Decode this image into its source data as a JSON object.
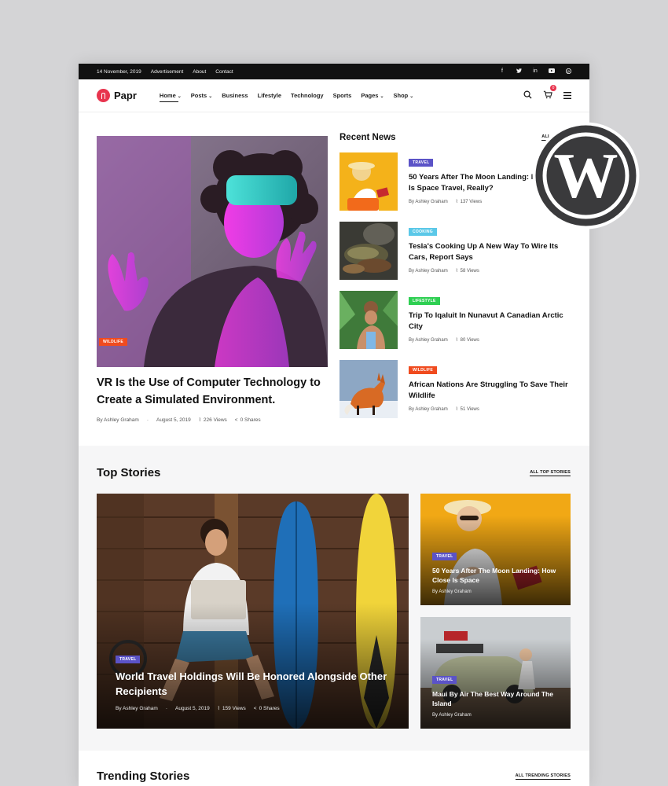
{
  "topbar": {
    "date": "14 November, 2019",
    "links": [
      "Advertisement",
      "About",
      "Contact"
    ],
    "social": [
      "f",
      "t",
      "in",
      "yt",
      "p"
    ]
  },
  "nav": {
    "logo": "Papr",
    "menu": [
      "Home",
      "Posts",
      "Business",
      "Lifestyle",
      "Technology",
      "Sports",
      "Pages",
      "Shop"
    ],
    "cart_count": "0"
  },
  "hero": {
    "badge": "WILDLIFE",
    "title": "VR Is the Use of Computer Technology to Create a Simulated Environment.",
    "author": "By Ashley Graham",
    "date": "August 5, 2019",
    "views": "226 Views",
    "shares": "0 Shares"
  },
  "recent": {
    "heading": "Recent News",
    "all_link": "ALL RECENT",
    "items": [
      {
        "badge": "TRAVEL",
        "title": "50 Years After The Moon Landing: How Close Is Space Travel, Really?",
        "author": "By Ashley Graham",
        "views": "137 Views"
      },
      {
        "badge": "COOKING",
        "title": "Tesla's Cooking Up A New Way To Wire Its Cars, Report Says",
        "author": "By Ashley Graham",
        "views": "58 Views"
      },
      {
        "badge": "LIFESTYLE",
        "title": "Trip To Iqaluit In Nunavut A Canadian Arctic City",
        "author": "By Ashley Graham",
        "views": "80 Views"
      },
      {
        "badge": "WILDLIFE",
        "title": "African Nations Are Struggling To Save Their Wildlife",
        "author": "By Ashley Graham",
        "views": "51 Views"
      }
    ]
  },
  "top_stories": {
    "heading": "Top Stories",
    "all_link": "ALL TOP STORIES",
    "main": {
      "badge": "TRAVEL",
      "title": "World Travel Holdings Will Be Honored Alongside Other Recipients",
      "author": "By Ashley Graham",
      "date": "August 5, 2019",
      "views": "159 Views",
      "shares": "0 Shares"
    },
    "side": [
      {
        "badge": "TRAVEL",
        "title": "50 Years After The Moon Landing: How Close Is Space",
        "author": "By Ashley Graham"
      },
      {
        "badge": "TRAVEL",
        "title": "Maui By Air The Best Way Around The Island",
        "author": "By Ashley Graham"
      }
    ]
  },
  "trending": {
    "heading": "Trending Stories",
    "all_link": "ALL TRENDING STORIES"
  },
  "colors": {
    "brand": "#e8344e",
    "wildlife": "#f04b1f",
    "travel": "#5b53c7",
    "cooking": "#5bc8e8",
    "lifestyle": "#2ecf52"
  }
}
